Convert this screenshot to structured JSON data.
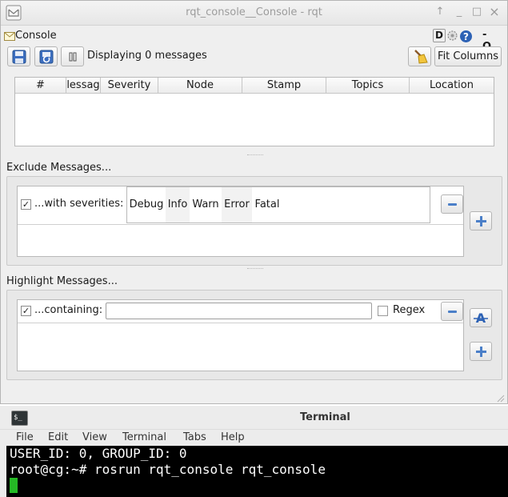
{
  "window": {
    "title": "rqt_console__Console - rqt",
    "controls": [
      "↑",
      "_",
      "□",
      "×"
    ]
  },
  "plugin": {
    "title": "Console",
    "help_letter": "D",
    "right_marks": "- O"
  },
  "toolbar": {
    "status": "Displaying 0 messages",
    "fit_columns_label": "Fit Columns"
  },
  "table": {
    "columns": [
      "#",
      "lessag",
      "Severity",
      "Node",
      "Stamp",
      "Topics",
      "Location"
    ]
  },
  "exclude": {
    "section_label": "Exclude Messages...",
    "filter_label": "...with severities:",
    "filter_checked": true,
    "severities": [
      "Debug",
      "Info",
      "Warn",
      "Error",
      "Fatal"
    ]
  },
  "highlight": {
    "section_label": "Highlight Messages...",
    "filter_label": "...containing:",
    "filter_checked": true,
    "text_value": "",
    "regex_label": "Regex",
    "regex_checked": false
  },
  "terminal": {
    "title": "Terminal",
    "menu": [
      "File",
      "Edit",
      "View",
      "Terminal",
      "Tabs",
      "Help"
    ],
    "lines": [
      "USER_ID: 0, GROUP_ID: 0",
      "root@cg:~# rosrun rqt_console rqt_console"
    ]
  },
  "colors": {
    "accent_blue": "#4b7fc8",
    "cursor_green": "#25b925",
    "terminal_bg": "#000000"
  }
}
